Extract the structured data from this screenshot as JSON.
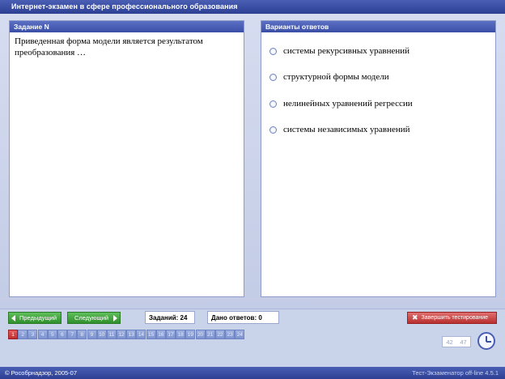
{
  "window": {
    "title": "Интернет-экзамен в сфере профессионального образования"
  },
  "question": {
    "header": "Задание N",
    "text": "Приведенная форма модели является результатом преобразования …"
  },
  "answers": {
    "header": "Варианты ответов",
    "options": [
      "системы рекурсивных уравнений",
      "структурной формы модели",
      "нелинейных уравнений регрессии",
      "системы независимых уравнений"
    ]
  },
  "nav": {
    "prev_label": "Предыдущий",
    "next_label": "Следующий",
    "tasks_label": "Заданий: 24",
    "answered_label": "Дано ответов: 0",
    "finish_label": "Завершить тестирование",
    "pages": [
      "1",
      "2",
      "3",
      "4",
      "5",
      "6",
      "7",
      "8",
      "9",
      "10",
      "11",
      "12",
      "13",
      "14",
      "15",
      "16",
      "17",
      "18",
      "19",
      "20",
      "21",
      "22",
      "23",
      "24"
    ],
    "active_page": "1"
  },
  "timer": {
    "minutes": "42",
    "seconds": "47"
  },
  "status": {
    "left": "© Рособрнадзор, 2005-07",
    "right": "Тест-Экзаменатор off-line 4.5.1"
  },
  "colors": {
    "titlebar": "#3a4ea6",
    "nav_green": "#2f8f2c",
    "finish_red": "#b83030",
    "active_page": "#c22f2f"
  }
}
